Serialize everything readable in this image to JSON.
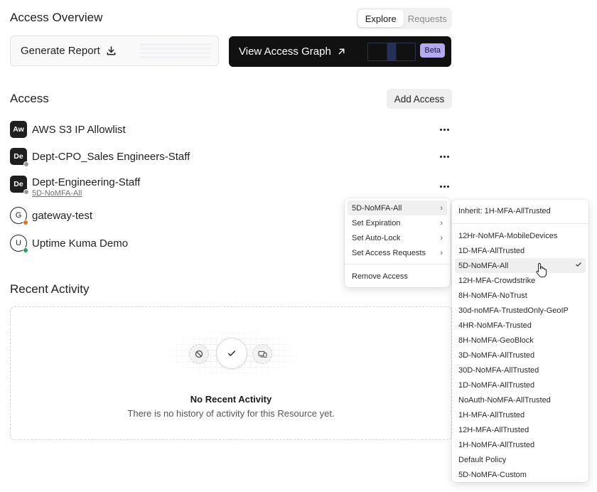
{
  "header": {
    "title": "Access Overview",
    "tabs": [
      {
        "label": "Explore",
        "active": true
      },
      {
        "label": "Requests",
        "active": false
      }
    ]
  },
  "actions": {
    "generate_report": "Generate Report",
    "view_graph": "View Access Graph",
    "beta": "Beta"
  },
  "access": {
    "title": "Access",
    "add_button": "Add Access",
    "items": [
      {
        "avatar": "Aw",
        "name": "AWS S3 IP Allowlist",
        "subtitle": "",
        "badge_color": ""
      },
      {
        "avatar": "De",
        "name": "Dept-CPO_Sales Engineers-Staff",
        "subtitle": "",
        "badge_color": "#9a9a9a"
      },
      {
        "avatar": "De",
        "name": "Dept-Engineering-Staff",
        "subtitle": "5D-NoMFA-All",
        "badge_color": "#9a9a9a"
      },
      {
        "avatar": "G",
        "name": "gateway-test",
        "subtitle": "",
        "badge_color": "#d9772b"
      },
      {
        "avatar": "U",
        "name": "Uptime Kuma Demo",
        "subtitle": "",
        "badge_color": "#22a55a"
      }
    ]
  },
  "recent": {
    "title": "Recent Activity",
    "empty_title": "No Recent Activity",
    "empty_subtitle": "There is no history of activity for this Resource yet."
  },
  "context_menu": {
    "items": [
      {
        "label": "5D-NoMFA-All",
        "submenu": true,
        "active": true
      },
      {
        "label": "Set Expiration",
        "submenu": true
      },
      {
        "label": "Set Auto-Lock",
        "submenu": true
      },
      {
        "label": "Set Access Requests",
        "submenu": true
      }
    ],
    "remove": "Remove Access"
  },
  "policy_menu": {
    "inherit": "Inherit: 1H-MFA-AllTrusted",
    "selected": "5D-NoMFA-All",
    "options": [
      "12Hr-NoMFA-MobileDevices",
      "1D-MFA-AllTrusted",
      "5D-NoMFA-All",
      "12H-MFA-Crowdstrike",
      "8H-NoMFA-NoTrust",
      "30d-noMFA-TrustedOnly-GeoIP",
      "4HR-NoMFA-Trusted",
      "8H-NoMFA-GeoBlock",
      "3D-NoMFA-AllTrusted",
      "30D-NoMFA-AllTrusted",
      "1D-NoMFA-AllTrusted",
      "NoAuth-NoMFA-AllTrusted",
      "1H-MFA-AllTrusted",
      "12H-MFA-AllTrusted",
      "1H-NoMFA-AllTrusted",
      "Default Policy",
      "5D-NoMFA-Custom"
    ]
  },
  "icons": {
    "download": "download-icon",
    "arrow": "arrow-up-right-icon",
    "more": "more-horizontal-icon",
    "chevron": "chevron-right-icon",
    "check": "check-icon",
    "ban": "ban-icon",
    "devices": "devices-icon",
    "pointer": "hand-pointer-icon"
  }
}
